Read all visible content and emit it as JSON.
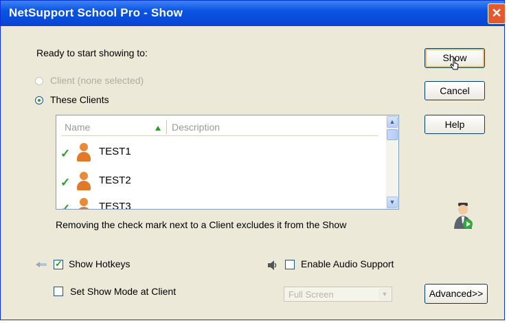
{
  "window": {
    "title": "NetSupport School Pro - Show",
    "close_label": "✕"
  },
  "dialog": {
    "ready_text": "Ready to start showing to:",
    "radio_client": "Client (none selected)",
    "radio_these_clients": "These Clients",
    "list": {
      "headers": {
        "name": "Name",
        "description": "Description"
      },
      "rows": [
        {
          "name": "TEST1",
          "checked": true
        },
        {
          "name": "TEST2",
          "checked": true
        },
        {
          "name": "TEST3",
          "checked": true
        }
      ],
      "scroll_up": "▲",
      "scroll_down": "▼"
    },
    "hint": "Removing the check mark next to a Client excludes it from the Show",
    "show_hotkeys": "Show Hotkeys",
    "set_show_mode": "Set Show Mode at Client",
    "enable_audio": "Enable Audio Support",
    "mode_select": {
      "value": "Full Screen",
      "arrow": "▼"
    }
  },
  "buttons": {
    "show": "Show",
    "cancel": "Cancel",
    "help": "Help",
    "advanced": "Advanced>>"
  },
  "colors": {
    "title_bar": "#0a54e3",
    "dialog_bg": "#ece9d8",
    "check_green": "#21a121",
    "close_red": "#e25a2d"
  }
}
